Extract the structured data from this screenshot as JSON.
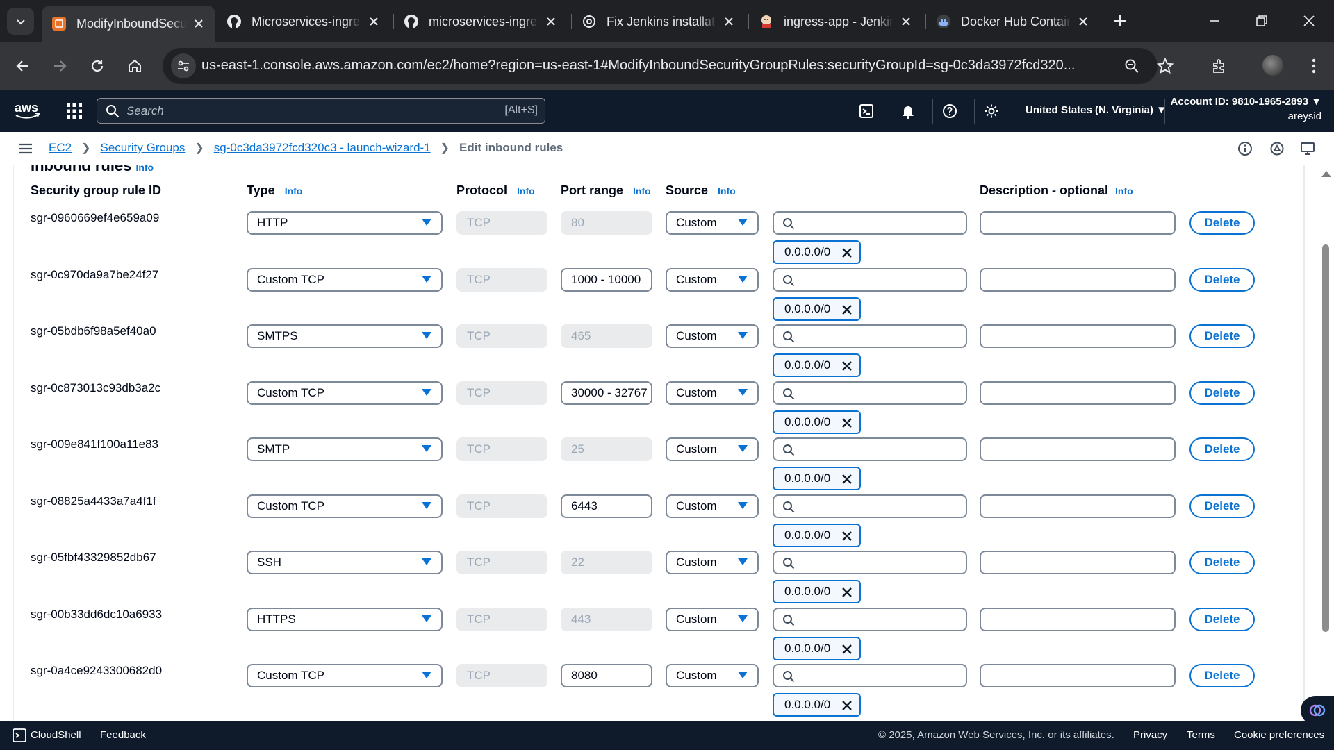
{
  "browser": {
    "tabs": [
      {
        "title": "ModifyInboundSecurityGroupRules",
        "icon": "aws-icon",
        "active": true
      },
      {
        "title": "Microservices-ingress",
        "icon": "github-icon",
        "active": false
      },
      {
        "title": "microservices-ingress",
        "icon": "github-icon",
        "active": false
      },
      {
        "title": "Fix Jenkins installation",
        "icon": "openai-icon",
        "active": false
      },
      {
        "title": "ingress-app - Jenkins",
        "icon": "jenkins-icon",
        "active": false
      },
      {
        "title": "Docker Hub Container",
        "icon": "docker-icon",
        "active": false
      }
    ],
    "url": "us-east-1.console.aws.amazon.com/ec2/home?region=us-east-1#ModifyInboundSecurityGroupRules:securityGroupId=sg-0c3da3972fcd320..."
  },
  "aws_nav": {
    "search_placeholder": "Search",
    "search_shortcut": "[Alt+S]",
    "region": "United States (N. Virginia) ▼",
    "account": "Account ID: 9810-1965-2893 ▼",
    "user": "areysid"
  },
  "breadcrumb": {
    "items": [
      "EC2",
      "Security Groups",
      "sg-0c3da3972fcd320c3 - launch-wizard-1"
    ],
    "current": "Edit inbound rules"
  },
  "section": {
    "title": "Inbound rules",
    "info": "Info"
  },
  "columns": {
    "rule_id": "Security group rule ID",
    "type": "Type",
    "protocol": "Protocol",
    "port_range": "Port range",
    "source": "Source",
    "description": "Description - optional",
    "info": "Info"
  },
  "rules": [
    {
      "id": "sgr-0960669ef4e659a09",
      "type": "HTTP",
      "protocol": "TCP",
      "port": "80",
      "port_editable": false,
      "source": "Custom",
      "cidr": "0.0.0.0/0"
    },
    {
      "id": "sgr-0c970da9a7be24f27",
      "type": "Custom TCP",
      "protocol": "TCP",
      "port": "1000 - 10000",
      "port_editable": true,
      "source": "Custom",
      "cidr": "0.0.0.0/0"
    },
    {
      "id": "sgr-05bdb6f98a5ef40a0",
      "type": "SMTPS",
      "protocol": "TCP",
      "port": "465",
      "port_editable": false,
      "source": "Custom",
      "cidr": "0.0.0.0/0"
    },
    {
      "id": "sgr-0c873013c93db3a2c",
      "type": "Custom TCP",
      "protocol": "TCP",
      "port": "30000 - 32767",
      "port_editable": true,
      "source": "Custom",
      "cidr": "0.0.0.0/0"
    },
    {
      "id": "sgr-009e841f100a11e83",
      "type": "SMTP",
      "protocol": "TCP",
      "port": "25",
      "port_editable": false,
      "source": "Custom",
      "cidr": "0.0.0.0/0"
    },
    {
      "id": "sgr-08825a4433a7a4f1f",
      "type": "Custom TCP",
      "protocol": "TCP",
      "port": "6443",
      "port_editable": true,
      "source": "Custom",
      "cidr": "0.0.0.0/0"
    },
    {
      "id": "sgr-05fbf43329852db67",
      "type": "SSH",
      "protocol": "TCP",
      "port": "22",
      "port_editable": false,
      "source": "Custom",
      "cidr": "0.0.0.0/0"
    },
    {
      "id": "sgr-00b33dd6dc10a6933",
      "type": "HTTPS",
      "protocol": "TCP",
      "port": "443",
      "port_editable": false,
      "source": "Custom",
      "cidr": "0.0.0.0/0"
    },
    {
      "id": "sgr-0a4ce9243300682d0",
      "type": "Custom TCP",
      "protocol": "TCP",
      "port": "8080",
      "port_editable": true,
      "source": "Custom",
      "cidr": "0.0.0.0/0"
    }
  ],
  "row_labels": {
    "delete": "Delete"
  },
  "footer": {
    "cloudshell": "CloudShell",
    "feedback": "Feedback",
    "copyright": "© 2025, Amazon Web Services, Inc. or its affiliates.",
    "privacy": "Privacy",
    "terms": "Terms",
    "cookies": "Cookie preferences"
  },
  "colors": {
    "aws_nav_bg": "#0f1b2a",
    "link": "#0972d3",
    "chrome_bg": "#202124"
  }
}
